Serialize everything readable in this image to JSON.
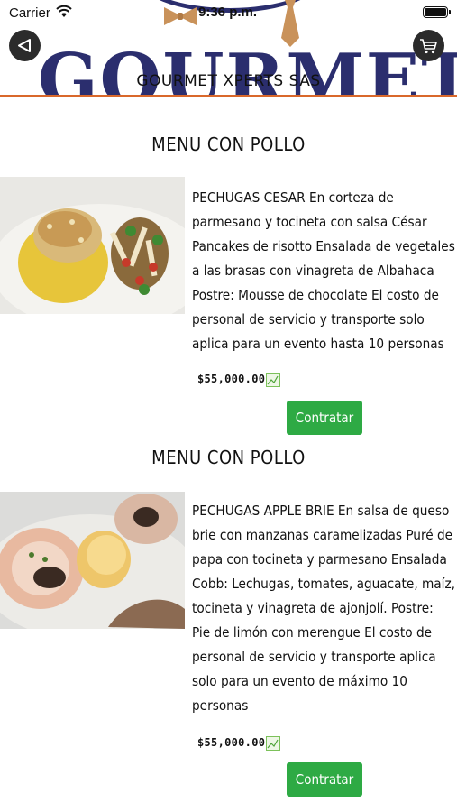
{
  "status_bar": {
    "carrier": "Carrier",
    "time": "9:36 p.m."
  },
  "header": {
    "logo_text": "GOURMET",
    "banner_title": "GOURMET XPERTS SAS"
  },
  "colors": {
    "accent_line": "#d9682b",
    "logo_navy": "#2b2e6e",
    "button_green": "#2eaa44"
  },
  "icons": {
    "back": "back-triangle-icon",
    "cart": "shopping-cart-icon",
    "price_badge": "image-placeholder-icon"
  },
  "menus": [
    {
      "section_title": "MENU CON POLLO",
      "image_alt": "dish-photo",
      "description": "PECHUGAS CESAR En corteza de parmesano y tocineta con salsa César Pancakes de risotto Ensalada de vegetales a las brasas con vinagreta de Albahaca Postre: Mousse de chocolate El costo de personal de servicio y transporte solo aplica para un evento hasta 10 personas",
      "price": "$55,000.00",
      "button_label": "Contratar"
    },
    {
      "section_title": "MENU CON POLLO",
      "image_alt": "dish-photo",
      "description": "PECHUGAS APPLE BRIE En salsa de queso brie con manzanas caramelizadas Puré de papa con tocineta y parmesano Ensalada Cobb: Lechugas, tomates, aguacate, maíz, tocineta y vinagreta de ajonjolí. Postre: Pie de limón con merengue El costo de personal de servicio y transporte aplica solo para un evento de máximo 10 personas",
      "price": "$55,000.00",
      "button_label": "Contratar"
    }
  ]
}
